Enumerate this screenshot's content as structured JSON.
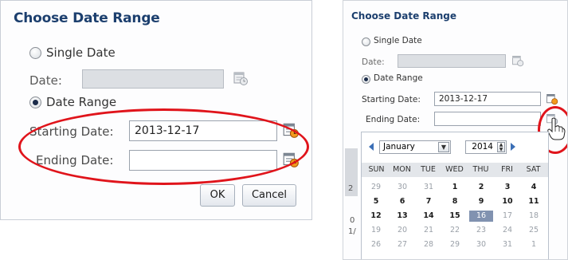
{
  "left_dialog": {
    "title": "Choose Date Range",
    "single_date_label": "Single Date",
    "date_label": "Date:",
    "date_range_label": "Date Range",
    "starting_date_label": "Starting Date:",
    "starting_date_value": "2013-12-17",
    "ending_date_label": "Ending Date:",
    "ending_date_value": "",
    "ok_label": "OK",
    "cancel_label": "Cancel"
  },
  "right_dialog": {
    "title": "Choose Date Range",
    "single_date_label": "Single Date",
    "date_label": "Date:",
    "date_range_label": "Date Range",
    "starting_date_label": "Starting Date:",
    "starting_date_value": "2013-12-17",
    "ending_date_label": "Ending Date:",
    "ending_date_value": "",
    "calendar": {
      "month": "January",
      "year": "2014",
      "weekdays": [
        "SUN",
        "MON",
        "TUE",
        "WED",
        "THU",
        "FRI",
        "SAT"
      ],
      "weeks": [
        [
          "29",
          "30",
          "31",
          "1",
          "2",
          "3",
          "4"
        ],
        [
          "5",
          "6",
          "7",
          "8",
          "9",
          "10",
          "11"
        ],
        [
          "12",
          "13",
          "14",
          "15",
          "16",
          "17",
          "18"
        ],
        [
          "19",
          "20",
          "21",
          "22",
          "23",
          "24",
          "25"
        ],
        [
          "26",
          "27",
          "28",
          "29",
          "30",
          "31",
          "1"
        ]
      ],
      "today": "16"
    },
    "background_fragments": [
      "2",
      "0",
      "1/"
    ]
  },
  "icons": {
    "calendar": "calendar-icon",
    "prev": "prev-month-icon",
    "next": "next-month-icon",
    "hand": "hand-pointer-icon"
  },
  "colors": {
    "title": "#1c3f6e",
    "highlight_oval": "#e0141b",
    "today": "#8192b0"
  }
}
